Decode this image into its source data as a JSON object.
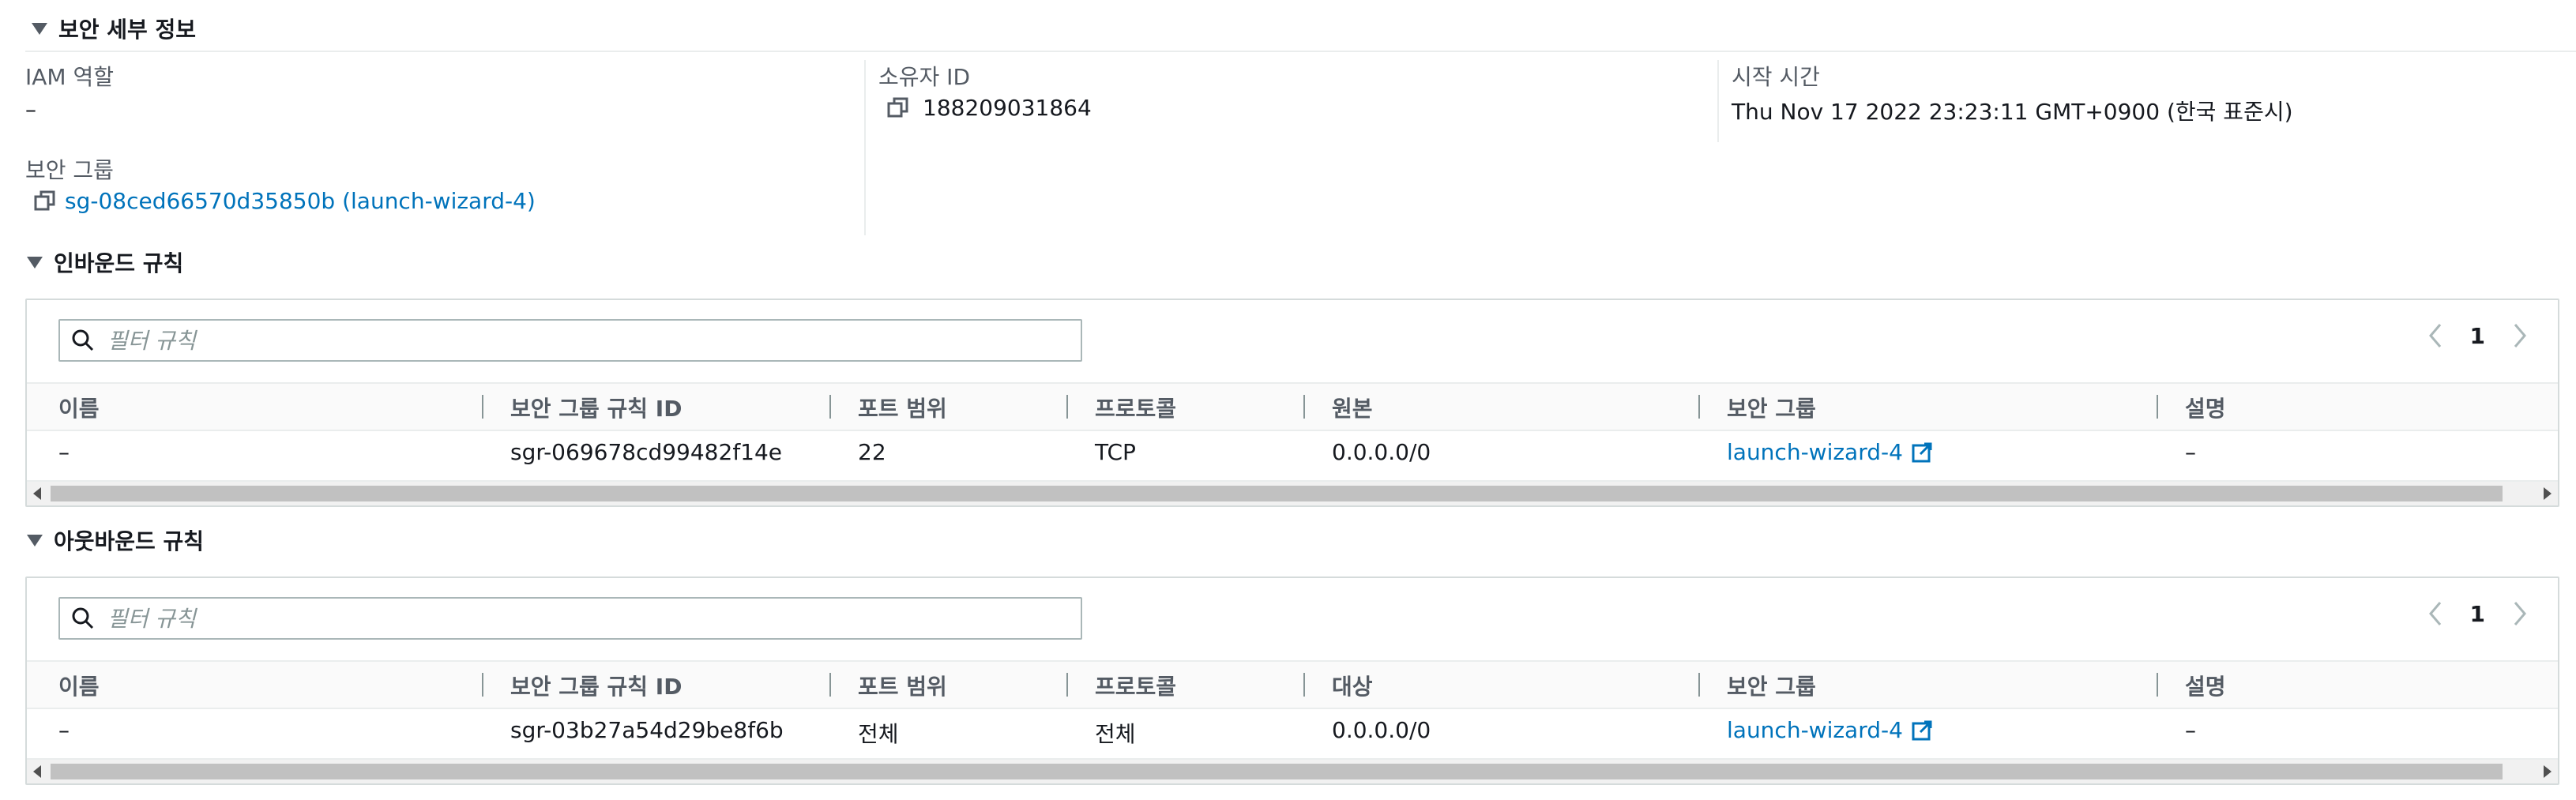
{
  "security_details": {
    "title": "보안 세부 정보",
    "iam_role": {
      "label": "IAM 역할",
      "value": "–"
    },
    "owner_id": {
      "label": "소유자 ID",
      "value": "188209031864"
    },
    "start_time": {
      "label": "시작 시간",
      "value": "Thu Nov 17 2022 23:23:11 GMT+0900 (한국 표준시)"
    },
    "security_groups": {
      "label": "보안 그룹",
      "value": "sg-08ced66570d35850b (launch-wizard-4)"
    }
  },
  "inbound": {
    "title": "인바운드 규칙",
    "filter_placeholder": "필터 규칙",
    "page": "1",
    "columns": [
      "이름",
      "보안 그룹 규칙 ID",
      "포트 범위",
      "프로토콜",
      "원본",
      "보안 그룹",
      "설명"
    ],
    "rows": [
      {
        "name": "–",
        "rule_id": "sgr-069678cd99482f14e",
        "port": "22",
        "protocol": "TCP",
        "source": "0.0.0.0/0",
        "group": "launch-wizard-4",
        "desc": "–"
      }
    ]
  },
  "outbound": {
    "title": "아웃바운드 규칙",
    "filter_placeholder": "필터 규칙",
    "page": "1",
    "columns": [
      "이름",
      "보안 그룹 규칙 ID",
      "포트 범위",
      "프로토콜",
      "대상",
      "보안 그룹",
      "설명"
    ],
    "rows": [
      {
        "name": "–",
        "rule_id": "sgr-03b27a54d29be8f6b",
        "port": "전체",
        "protocol": "전체",
        "source": "0.0.0.0/0",
        "group": "launch-wizard-4",
        "desc": "–"
      }
    ]
  },
  "colors": {
    "link": "#0073bb",
    "text": "#16191f",
    "muted": "#545b64",
    "border": "#eaeded"
  }
}
